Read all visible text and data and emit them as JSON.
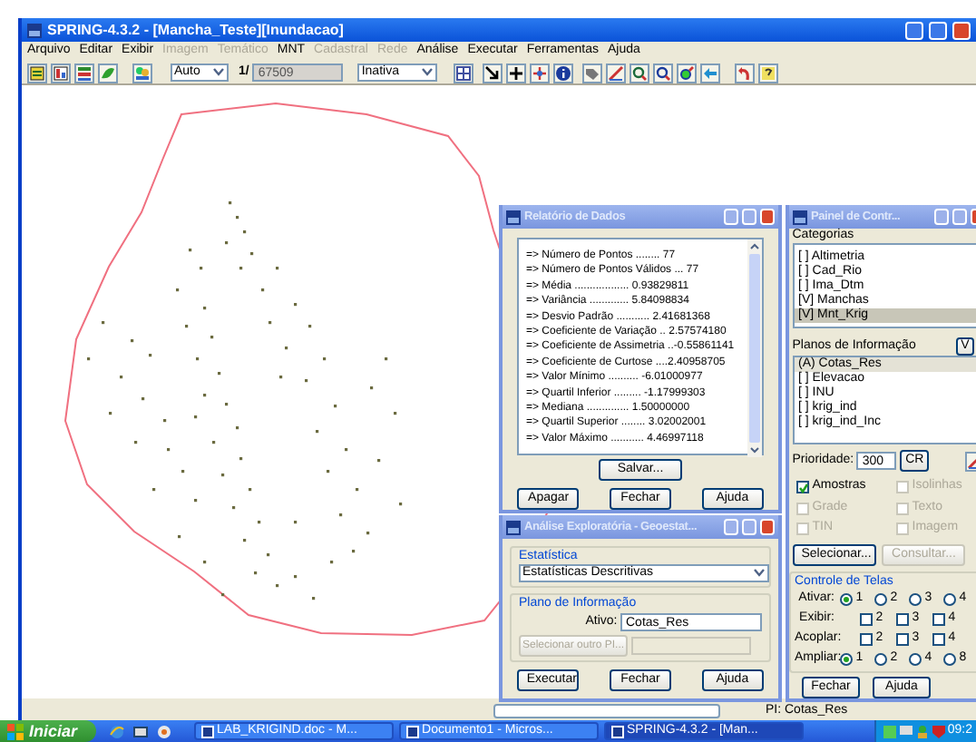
{
  "window": {
    "title": "SPRING-4.3.2 - [Mancha_Teste][Inundacao]"
  },
  "menu": [
    {
      "label": "Arquivo",
      "disabled": false
    },
    {
      "label": "Editar",
      "disabled": false
    },
    {
      "label": "Exibir",
      "disabled": false
    },
    {
      "label": "Imagem",
      "disabled": true
    },
    {
      "label": "Temático",
      "disabled": true
    },
    {
      "label": "MNT",
      "disabled": false
    },
    {
      "label": "Cadastral",
      "disabled": true
    },
    {
      "label": "Rede",
      "disabled": true
    },
    {
      "label": "Análise",
      "disabled": false
    },
    {
      "label": "Executar",
      "disabled": false
    },
    {
      "label": "Ferramentas",
      "disabled": false
    },
    {
      "label": "Ajuda",
      "disabled": false
    }
  ],
  "toolbar": {
    "zoom_mode": "Auto",
    "scale_label": "1/",
    "scale": "67509",
    "cursor_mode": "Inativa"
  },
  "report_window": {
    "title": "Relatório de Dados",
    "lines": [
      "=> Número de Pontos ........ 77",
      "=> Número de Pontos Válidos ... 77",
      "=> Média .................. 0.93829811",
      "=> Variância ............. 5.84098834",
      "=> Desvio Padrão ........... 2.41681368",
      "=> Coeficiente de Variação .. 2.57574180",
      "=> Coeficiente de Assimetria ..-0.55861141",
      "=> Coeficiente de Curtose ....2.40958705",
      "=> Valor Mínimo .......... -6.01000977",
      "=> Quartil Inferior ......... -1.17999303",
      "=> Mediana .............. 1.50000000",
      "=> Quartil Superior ........ 3.02002001",
      "=> Valor Máximo ........... 4.46997118"
    ],
    "save_button": "Salvar...",
    "buttons": [
      "Apagar",
      "Fechar",
      "Ajuda"
    ]
  },
  "analysis_window": {
    "title": "Análise Exploratória - Geoestat...",
    "statistic_group": "Estatística",
    "statistic": "Estatísticas Descritivas",
    "plan_group": "Plano de Informação",
    "active_label": "Ativo:",
    "active_value": "Cotas_Res",
    "select_button": "Selecionar outro PI...",
    "buttons": [
      "Executar",
      "Fechar",
      "Ajuda"
    ]
  },
  "control_panel": {
    "title": "Painel de Contr...",
    "categories_label": "Categorias",
    "categories": [
      {
        "label": "[ ] Altimetria",
        "selected": false
      },
      {
        "label": "[ ] Cad_Rio",
        "selected": false
      },
      {
        "label": "[ ] Ima_Dtm",
        "selected": false
      },
      {
        "label": "[V] Manchas",
        "selected": false
      },
      {
        "label": "[V] Mnt_Krig",
        "selected": true
      }
    ],
    "plans_label": "Planos de Informação",
    "plans_button": "V",
    "plans": [
      {
        "label": "(A) Cotas_Res",
        "selected": true
      },
      {
        "label": "[ ] Elevacao",
        "selected": false
      },
      {
        "label": "[ ] INU",
        "selected": false
      },
      {
        "label": "[ ] krig_ind",
        "selected": false
      },
      {
        "label": "[ ] krig_ind_Inc",
        "selected": false
      }
    ],
    "priority_label": "Prioridade:",
    "priority": "300",
    "cr_button": "CR",
    "layers": [
      {
        "label": "Amostras",
        "checked": true,
        "disabled": false
      },
      {
        "label": "Isolinhas",
        "checked": false,
        "disabled": true
      },
      {
        "label": "Grade",
        "checked": false,
        "disabled": true
      },
      {
        "label": "Texto",
        "checked": false,
        "disabled": true
      },
      {
        "label": "TIN",
        "checked": false,
        "disabled": true
      },
      {
        "label": "Imagem",
        "checked": false,
        "disabled": true
      }
    ],
    "select_button": "Selecionar...",
    "query_button": "Consultar...",
    "screens_group": "Controle de Telas",
    "screen_rows": [
      {
        "label": "Ativar:",
        "kind": "radio",
        "options": [
          {
            "label": "1",
            "selected": true
          },
          {
            "label": "2",
            "selected": false
          },
          {
            "label": "3",
            "selected": false
          },
          {
            "label": "4",
            "selected": false
          }
        ]
      },
      {
        "label": "Exibir:",
        "kind": "check",
        "options": [
          {
            "label": "2",
            "selected": false
          },
          {
            "label": "3",
            "selected": false
          },
          {
            "label": "4",
            "selected": false
          }
        ]
      },
      {
        "label": "Acoplar:",
        "kind": "check",
        "options": [
          {
            "label": "2",
            "selected": false
          },
          {
            "label": "3",
            "selected": false
          },
          {
            "label": "4",
            "selected": false
          }
        ]
      },
      {
        "label": "Ampliar:",
        "kind": "radio",
        "options": [
          {
            "label": "1",
            "selected": true
          },
          {
            "label": "2",
            "selected": false
          },
          {
            "label": "4",
            "selected": false
          },
          {
            "label": "8",
            "selected": false
          }
        ]
      }
    ],
    "buttons": [
      "Fechar",
      "Ajuda"
    ]
  },
  "status_bar": {
    "pi": "PI: Cotas_Res"
  },
  "taskbar": {
    "start": "Iniciar",
    "tasks": [
      {
        "label": "LAB_KRIGIND.doc - M...",
        "selected": false
      },
      {
        "label": "Documento1 - Micros...",
        "selected": false
      },
      {
        "label": "SPRING-4.3.2 - [Man...",
        "selected": true
      }
    ],
    "clock": "09:2"
  }
}
